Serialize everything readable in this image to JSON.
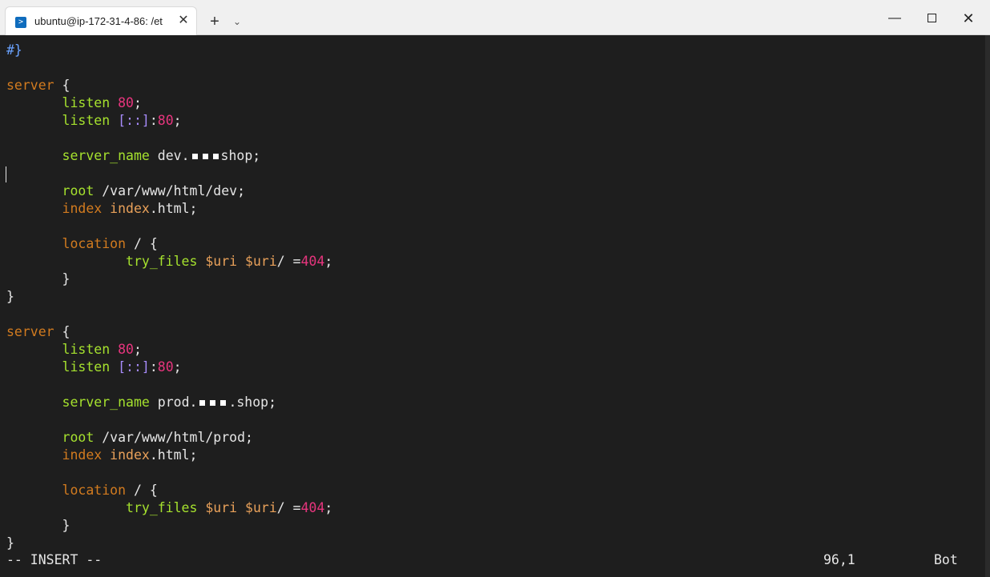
{
  "window": {
    "tab_title": "ubuntu@ip-172-31-4-86: /et",
    "tab_icon": "terminal-icon",
    "close_tab": "✕",
    "new_tab": "+",
    "dropdown": "⌄",
    "minimize": "—",
    "close": "✕"
  },
  "editor": {
    "lines": {
      "l1": "#}",
      "server1": "server",
      "brace_open": "{",
      "listen": "listen",
      "port80": "80",
      "ipv6": "[::]",
      "server_name": "server_name",
      "dev_host_prefix": "dev.",
      "dev_host_suffix": "shop;",
      "root": "root",
      "dev_root_path": "/var/www/html/dev;",
      "index": "index",
      "index_value": "index",
      "html_ext": ".html;",
      "location": "location",
      "location_path": "/ {",
      "try_files": "try_files",
      "uri1": "$uri",
      "uri2": "$uri",
      "slash_eq": "/ =",
      "code404": "404",
      "close_inner": "}",
      "close_outer": "}",
      "prod_host_prefix": "prod.",
      "prod_host_suffix": ".shop;",
      "prod_root_path": "/var/www/html/prod;",
      "semicolon": ";"
    },
    "status": {
      "mode": "-- INSERT --",
      "position": "96,1",
      "scroll": "Bot"
    }
  },
  "colors": {
    "background": "#1e1e1e",
    "keyword": "#d27b1f",
    "directive": "#a6e22e",
    "number": "#e8357e",
    "bracket": "#a78bfa",
    "variable": "#e9a15a"
  }
}
